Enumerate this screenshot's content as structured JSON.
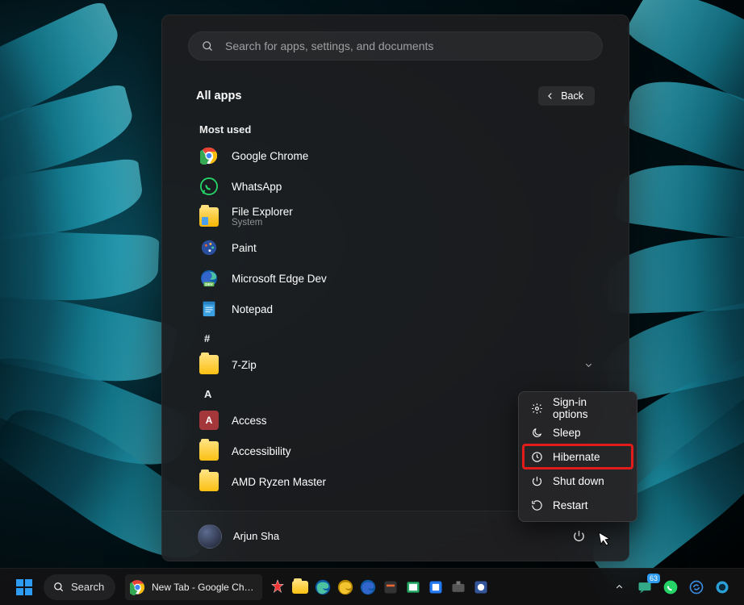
{
  "search": {
    "placeholder": "Search for apps, settings, and documents"
  },
  "header": {
    "title": "All apps",
    "back": "Back"
  },
  "sections": {
    "most_used_label": "Most used",
    "hash_label": "#",
    "a_label": "A"
  },
  "apps": {
    "chrome": "Google Chrome",
    "whatsapp": "WhatsApp",
    "file_explorer": "File Explorer",
    "file_explorer_sub": "System",
    "paint": "Paint",
    "edge_dev": "Microsoft Edge Dev",
    "notepad": "Notepad",
    "seven_zip": "7-Zip",
    "access": "Access",
    "accessibility": "Accessibility",
    "amd": "AMD Ryzen Master"
  },
  "user": {
    "name": "Arjun Sha"
  },
  "power_menu": {
    "signin": "Sign-in options",
    "sleep": "Sleep",
    "hibernate": "Hibernate",
    "shutdown": "Shut down",
    "restart": "Restart"
  },
  "taskbar": {
    "search_label": "Search",
    "chrome_task": "New Tab - Google Chrom",
    "tray_badge": "63"
  }
}
